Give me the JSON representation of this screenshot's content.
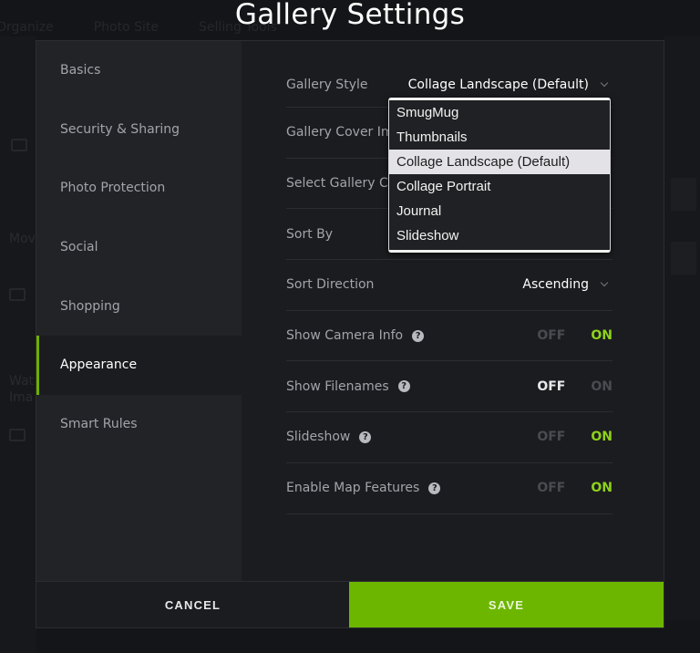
{
  "background": {
    "nav": [
      "Organize",
      "Photo Site",
      "Selling Tools"
    ],
    "left_items": [
      "Mov",
      "Wat",
      "Ima"
    ]
  },
  "modal": {
    "title": "Gallery Settings",
    "sidebar": {
      "items": [
        {
          "label": "Basics",
          "active": false
        },
        {
          "label": "Security & Sharing",
          "active": false
        },
        {
          "label": "Photo Protection",
          "active": false
        },
        {
          "label": "Social",
          "active": false
        },
        {
          "label": "Shopping",
          "active": false
        },
        {
          "label": "Appearance",
          "active": true
        },
        {
          "label": "Smart Rules",
          "active": false
        }
      ]
    },
    "settings": {
      "gallery_style": {
        "label": "Gallery Style",
        "value": "Collage Landscape (Default)"
      },
      "gallery_cover": {
        "label": "Gallery Cover Im"
      },
      "gallery_color": {
        "label": "Select Gallery Co"
      },
      "sort_by": {
        "label": "Sort By"
      },
      "sort_direction": {
        "label": "Sort Direction",
        "value": "Ascending"
      },
      "toggles": [
        {
          "label": "Show Camera Info",
          "state": "ON"
        },
        {
          "label": "Show Filenames",
          "state": "OFF"
        },
        {
          "label": "Slideshow",
          "state": "ON"
        },
        {
          "label": "Enable Map Features",
          "state": "ON"
        }
      ],
      "off_label": "OFF",
      "on_label": "ON",
      "help_glyph": "?"
    },
    "dropdown": {
      "options": [
        "SmugMug",
        "Thumbnails",
        "Collage Landscape (Default)",
        "Collage Portrait",
        "Journal",
        "Slideshow"
      ],
      "selected": "Collage Landscape (Default)"
    },
    "footer": {
      "cancel_label": "CANCEL",
      "save_label": "SAVE"
    },
    "colors": {
      "accent": "#6db600",
      "on_text": "#8ed21a"
    }
  }
}
